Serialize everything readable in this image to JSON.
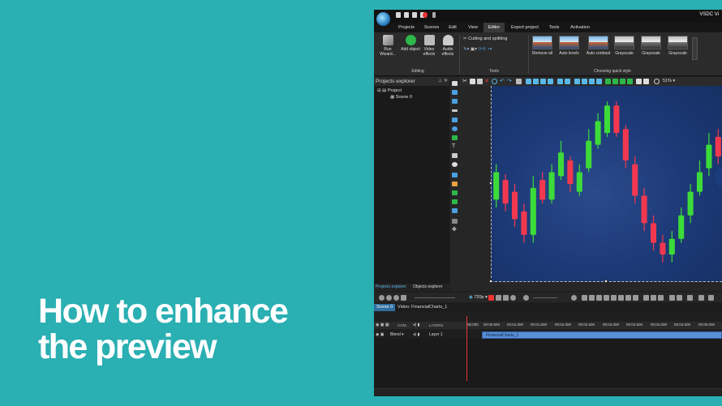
{
  "headline": {
    "line1": "How to enhance",
    "line2": "the preview"
  },
  "app": {
    "title": "VSDC Vi",
    "menu": [
      "Projects",
      "Scenes",
      "Edit",
      "View",
      "Editor",
      "Export project",
      "Tools",
      "Activation"
    ],
    "active_menu": "Editor"
  },
  "ribbon": {
    "run_wizard": "Run Wizard...",
    "add_object": "Add object",
    "video_effects": "Video effects",
    "audio_effects": "Audio effects",
    "editing_label": "Editing",
    "cutting": "Cutting and splitting",
    "tools_label": "Tools",
    "quick_styles": [
      "Remove all",
      "Auto levels",
      "Auto contrast",
      "Grayscale",
      "Grayscale",
      "Grayscale"
    ],
    "quick_style_label": "Choosing quick style"
  },
  "projects_explorer": {
    "title": "Projects explorer",
    "project": "Project",
    "scene": "Scene 0",
    "tabs": [
      "Projects explorer",
      "Objects explorer"
    ]
  },
  "editor_toolbar": {
    "zoom": "51%"
  },
  "timeline": {
    "resolution": "720p",
    "tabs": [
      "Scene 0",
      "Video: FinancialCharts_1"
    ],
    "ruler_ticks": [
      "00:000",
      "00:00.500",
      "00:01.000",
      "00:01.500",
      "00:02.000",
      "00:02.500",
      "00:03.000",
      "00:03.500",
      "00:04.000",
      "00:04.500",
      "00:05.000"
    ],
    "com_label": "COM...",
    "layers_label": "LAYERS",
    "blend_label": "Blend",
    "layer_name": "Layer 1",
    "clip_name": "FinancialCharts_1"
  },
  "chart_candles": [
    {
      "c": "g",
      "o": 0.42,
      "c2": 0.56,
      "h": 0.6,
      "l": 0.38
    },
    {
      "c": "r",
      "o": 0.52,
      "c2": 0.4,
      "h": 0.55,
      "l": 0.36
    },
    {
      "c": "r",
      "o": 0.46,
      "c2": 0.32,
      "h": 0.5,
      "l": 0.28
    },
    {
      "c": "r",
      "o": 0.36,
      "c2": 0.24,
      "h": 0.4,
      "l": 0.2
    },
    {
      "c": "g",
      "o": 0.24,
      "c2": 0.48,
      "h": 0.54,
      "l": 0.2
    },
    {
      "c": "r",
      "o": 0.52,
      "c2": 0.42,
      "h": 0.56,
      "l": 0.4
    },
    {
      "c": "g",
      "o": 0.42,
      "c2": 0.56,
      "h": 0.6,
      "l": 0.4
    },
    {
      "c": "g",
      "o": 0.54,
      "c2": 0.66,
      "h": 0.72,
      "l": 0.52
    },
    {
      "c": "r",
      "o": 0.62,
      "c2": 0.5,
      "h": 0.64,
      "l": 0.46
    },
    {
      "c": "g",
      "o": 0.46,
      "c2": 0.56,
      "h": 0.6,
      "l": 0.44
    },
    {
      "c": "g",
      "o": 0.58,
      "c2": 0.72,
      "h": 0.78,
      "l": 0.56
    },
    {
      "c": "g",
      "o": 0.7,
      "c2": 0.82,
      "h": 0.86,
      "l": 0.68
    },
    {
      "c": "g",
      "o": 0.76,
      "c2": 0.9,
      "h": 0.92,
      "l": 0.74
    },
    {
      "c": "r",
      "o": 0.9,
      "c2": 0.76,
      "h": 0.92,
      "l": 0.74
    },
    {
      "c": "r",
      "o": 0.78,
      "c2": 0.62,
      "h": 0.8,
      "l": 0.58
    },
    {
      "c": "r",
      "o": 0.6,
      "c2": 0.44,
      "h": 0.64,
      "l": 0.4
    },
    {
      "c": "r",
      "o": 0.44,
      "c2": 0.3,
      "h": 0.48,
      "l": 0.26
    },
    {
      "c": "r",
      "o": 0.3,
      "c2": 0.2,
      "h": 0.34,
      "l": 0.16
    },
    {
      "c": "r",
      "o": 0.2,
      "c2": 0.14,
      "h": 0.24,
      "l": 0.1
    },
    {
      "c": "g",
      "o": 0.14,
      "c2": 0.22,
      "h": 0.26,
      "l": 0.1
    },
    {
      "c": "g",
      "o": 0.22,
      "c2": 0.34,
      "h": 0.38,
      "l": 0.2
    },
    {
      "c": "g",
      "o": 0.34,
      "c2": 0.46,
      "h": 0.5,
      "l": 0.3
    },
    {
      "c": "g",
      "o": 0.46,
      "c2": 0.56,
      "h": 0.62,
      "l": 0.44
    },
    {
      "c": "g",
      "o": 0.58,
      "c2": 0.7,
      "h": 0.76,
      "l": 0.54
    },
    {
      "c": "r",
      "o": 0.74,
      "c2": 0.64,
      "h": 0.78,
      "l": 0.6
    }
  ],
  "colors": {
    "bg": "#2aafb2",
    "green": "#3ddb39",
    "red": "#f2384f",
    "preview": "#1d3a78"
  }
}
